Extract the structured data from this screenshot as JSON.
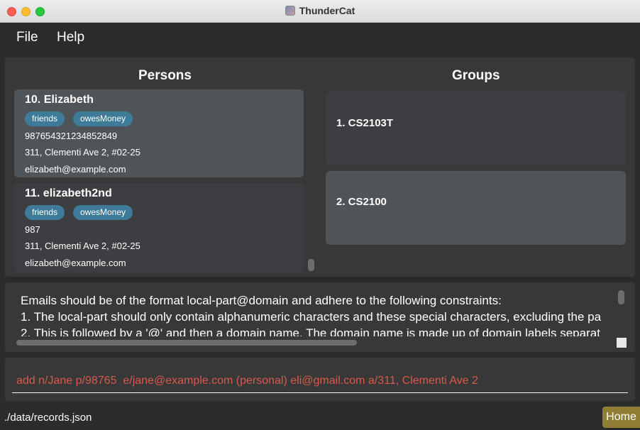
{
  "window": {
    "title": "ThunderCat"
  },
  "menu": {
    "file": "File",
    "help": "Help"
  },
  "persons": {
    "title": "Persons",
    "items": [
      {
        "index_name": "10.  Elizabeth",
        "tags": [
          "friends",
          "owesMoney"
        ],
        "phone": "987654321234852849",
        "address": "311, Clementi Ave 2, #02-25",
        "email": "elizabeth@example.com"
      },
      {
        "index_name": "11.  elizabeth2nd",
        "tags": [
          "friends",
          "owesMoney"
        ],
        "phone": "987",
        "address": "311, Clementi Ave 2, #02-25",
        "email": "elizabeth@example.com"
      }
    ]
  },
  "groups": {
    "title": "Groups",
    "items": [
      {
        "label": "1.  CS2103T"
      },
      {
        "label": "2.  CS2100"
      }
    ]
  },
  "result": {
    "lines": [
      "Emails should be of the format local-part@domain and adhere to the following constraints:",
      "1. The local-part should only contain alphanumeric characters and these special characters, excluding the pa",
      "2. This is followed by a '@' and then a domain name. The domain name is made up of domain labels separat"
    ]
  },
  "command": {
    "value": "add n/Jane p/98765  e/jane@example.com (personal) eli@gmail.com a/311, Clementi Ave 2"
  },
  "status": {
    "path": "./data/records.json",
    "home": "Home"
  }
}
